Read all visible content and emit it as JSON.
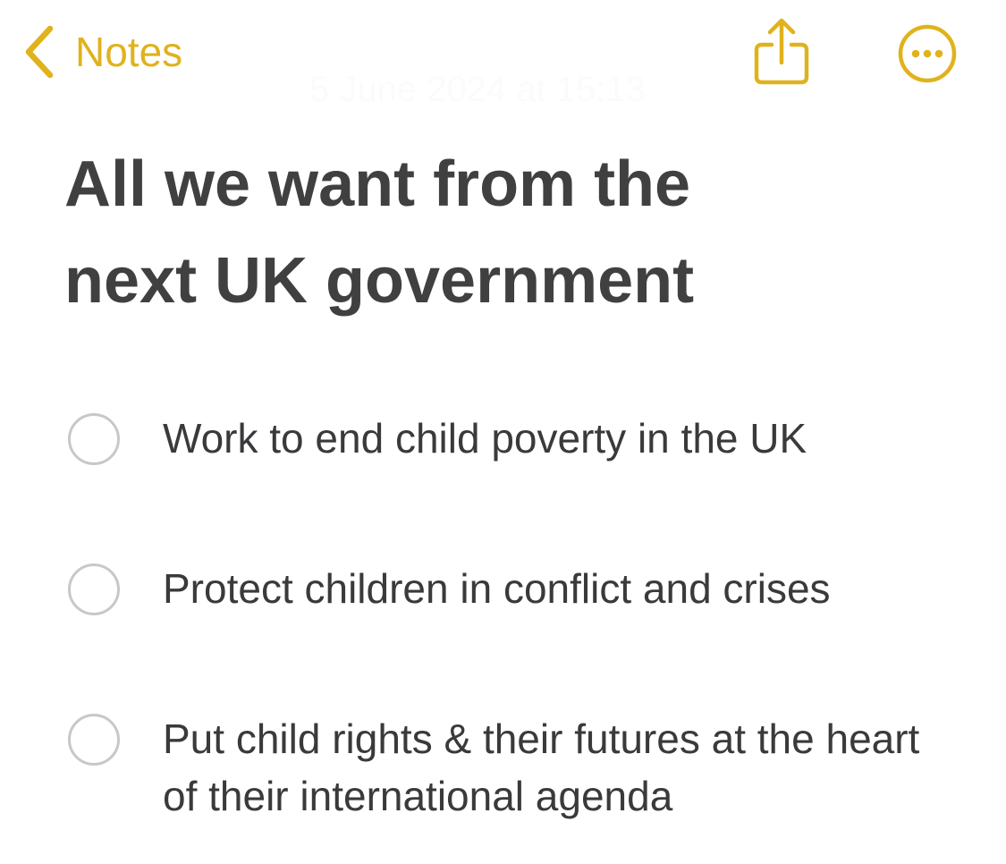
{
  "nav": {
    "back_label": "Notes",
    "share_icon": "share-icon",
    "more_icon": "ellipsis-circle-icon",
    "accent_color": "#e0b21c"
  },
  "note": {
    "timestamp": "5 June 2024 at 15:13",
    "title": "All we want from the next UK government",
    "checklist": [
      {
        "text": "Work to end child poverty in the UK",
        "checked": false
      },
      {
        "text": "Protect children in conflict and crises",
        "checked": false
      },
      {
        "text": "Put child rights & their futures at the heart of their international agenda",
        "checked": false
      }
    ]
  }
}
